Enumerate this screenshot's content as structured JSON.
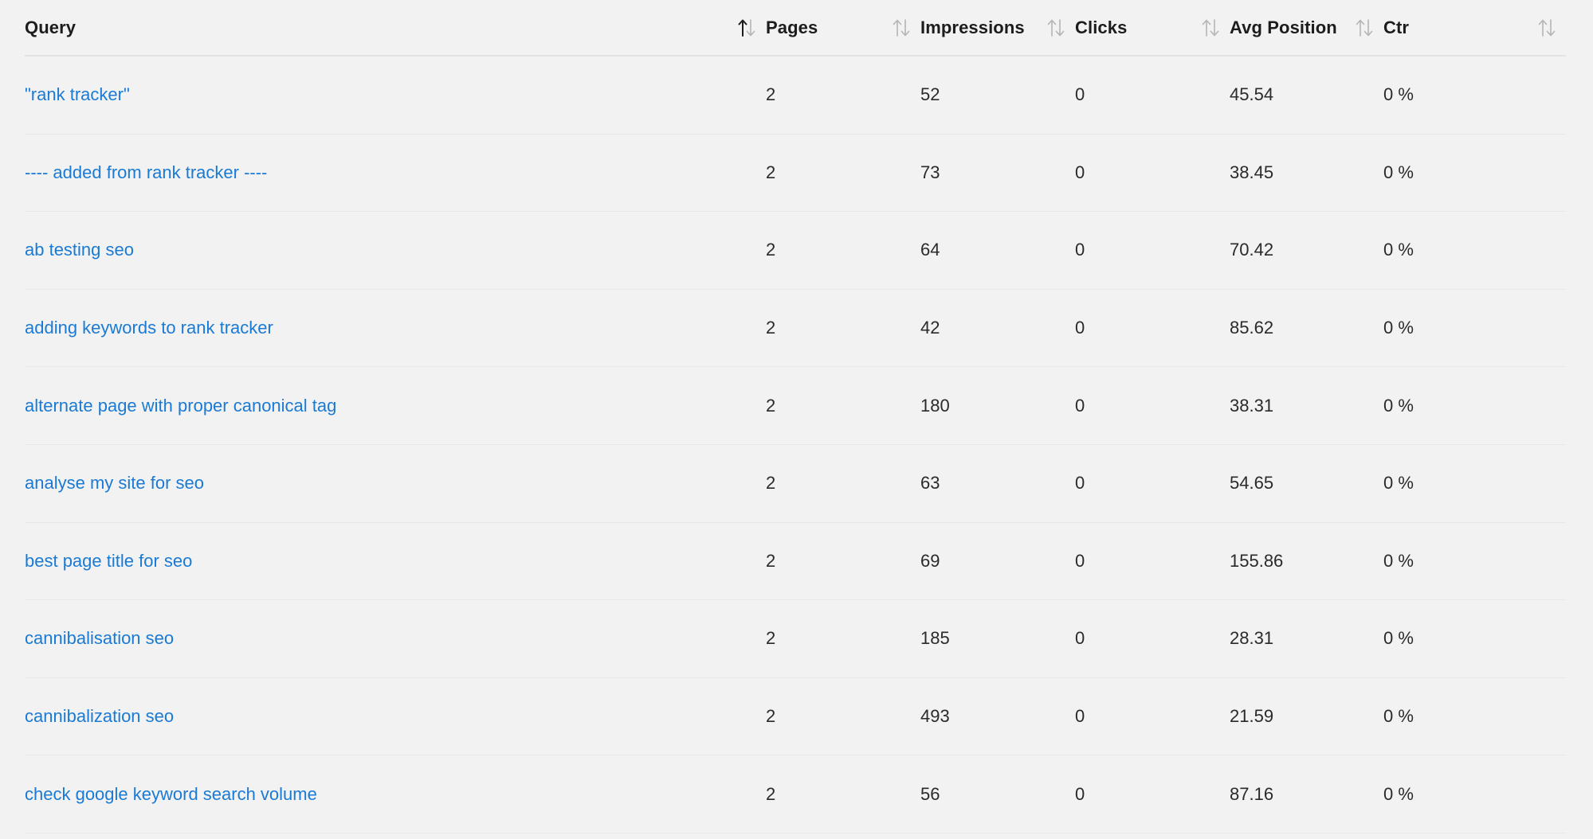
{
  "table": {
    "headers": {
      "query": "Query",
      "pages": "Pages",
      "impressions": "Impressions",
      "clicks": "Clicks",
      "avg_position": "Avg Position",
      "ctr": "Ctr"
    },
    "active_sort_column": "query",
    "colors": {
      "link": "#1a7ad4",
      "sort_active": "#1c1c1c",
      "sort_inactive": "#b5b5b5"
    },
    "rows": [
      {
        "query": "\"rank tracker\"",
        "pages": "2",
        "impressions": "52",
        "clicks": "0",
        "avg_position": "45.54",
        "ctr": "0 %"
      },
      {
        "query": "---- added from rank tracker ----",
        "pages": "2",
        "impressions": "73",
        "clicks": "0",
        "avg_position": "38.45",
        "ctr": "0 %"
      },
      {
        "query": "ab testing seo",
        "pages": "2",
        "impressions": "64",
        "clicks": "0",
        "avg_position": "70.42",
        "ctr": "0 %"
      },
      {
        "query": "adding keywords to rank tracker",
        "pages": "2",
        "impressions": "42",
        "clicks": "0",
        "avg_position": "85.62",
        "ctr": "0 %"
      },
      {
        "query": "alternate page with proper canonical tag",
        "pages": "2",
        "impressions": "180",
        "clicks": "0",
        "avg_position": "38.31",
        "ctr": "0 %"
      },
      {
        "query": "analyse my site for seo",
        "pages": "2",
        "impressions": "63",
        "clicks": "0",
        "avg_position": "54.65",
        "ctr": "0 %"
      },
      {
        "query": "best page title for seo",
        "pages": "2",
        "impressions": "69",
        "clicks": "0",
        "avg_position": "155.86",
        "ctr": "0 %"
      },
      {
        "query": "cannibalisation seo",
        "pages": "2",
        "impressions": "185",
        "clicks": "0",
        "avg_position": "28.31",
        "ctr": "0 %"
      },
      {
        "query": "cannibalization seo",
        "pages": "2",
        "impressions": "493",
        "clicks": "0",
        "avg_position": "21.59",
        "ctr": "0 %"
      },
      {
        "query": "check google keyword search volume",
        "pages": "2",
        "impressions": "56",
        "clicks": "0",
        "avg_position": "87.16",
        "ctr": "0 %"
      }
    ]
  }
}
